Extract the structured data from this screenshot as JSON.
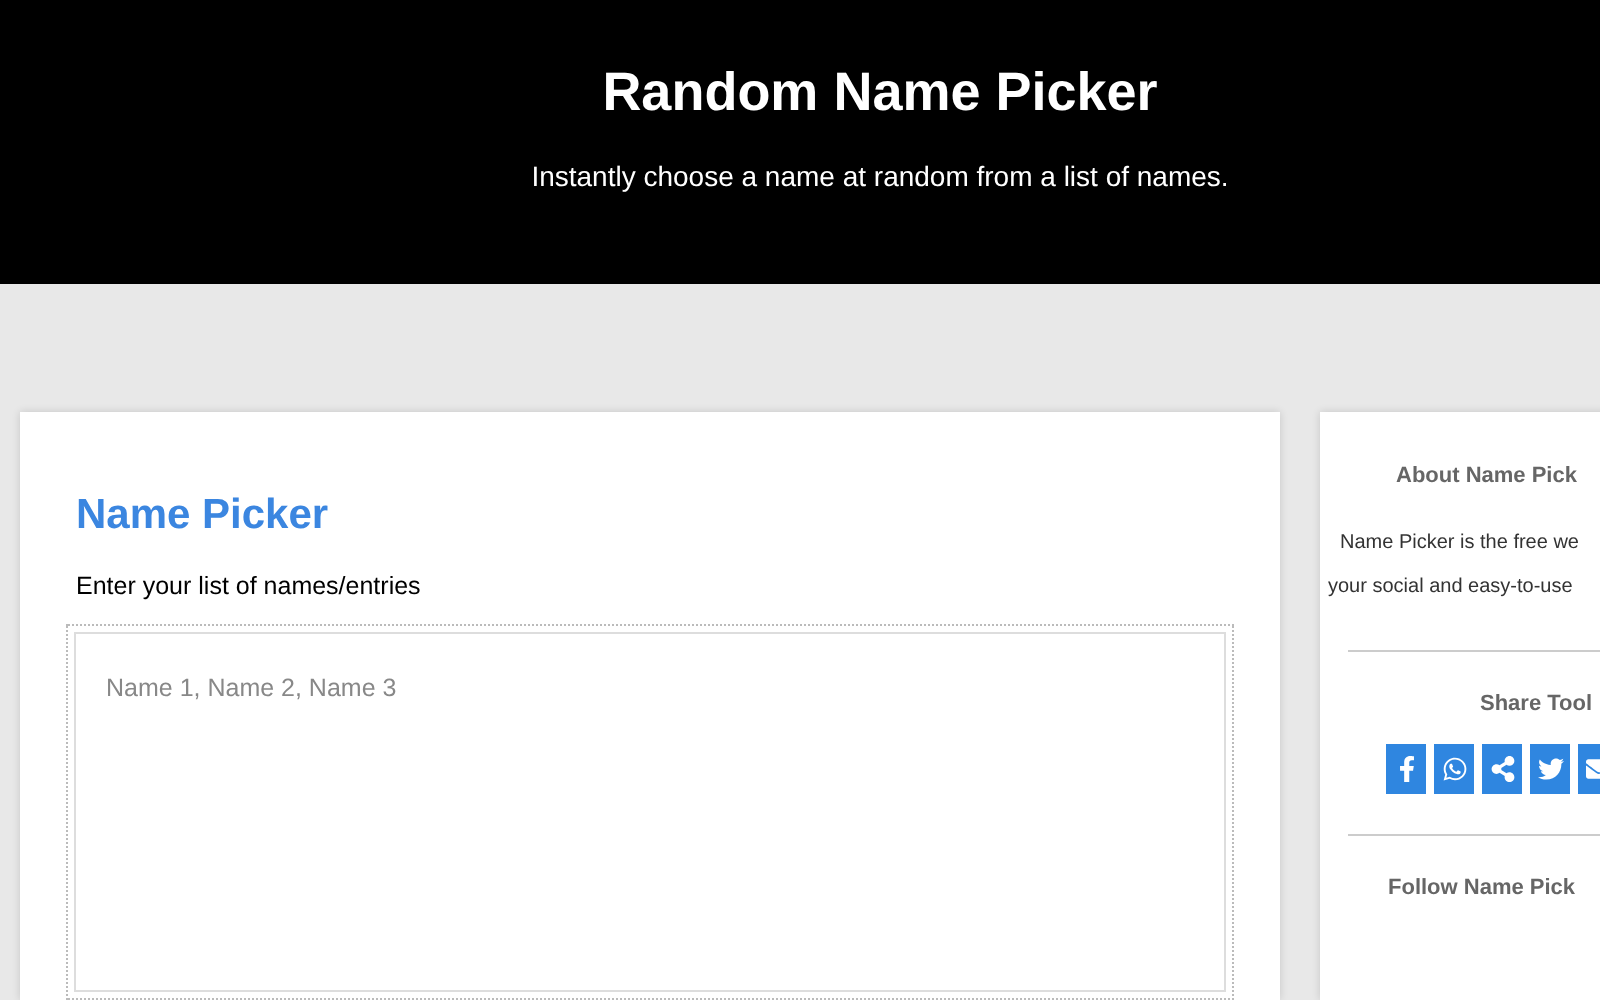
{
  "header": {
    "title": "Random Name Picker",
    "subtitle": "Instantly choose a name at random from a list of names."
  },
  "picker": {
    "title": "Name Picker",
    "label": "Enter your list of names/entries",
    "placeholder": "Name 1, Name 2, Name 3"
  },
  "sidebar": {
    "about_title": "About Name Pick",
    "about_lines": [
      "Name Picker is the free we",
      "your social and easy-to-use"
    ],
    "share_title": "Share Tool",
    "share_buttons": [
      {
        "kind": "facebook"
      },
      {
        "kind": "whatsapp"
      },
      {
        "kind": "share"
      },
      {
        "kind": "twitter"
      },
      {
        "kind": "email"
      }
    ],
    "follow_title": "Follow Name Pick"
  }
}
